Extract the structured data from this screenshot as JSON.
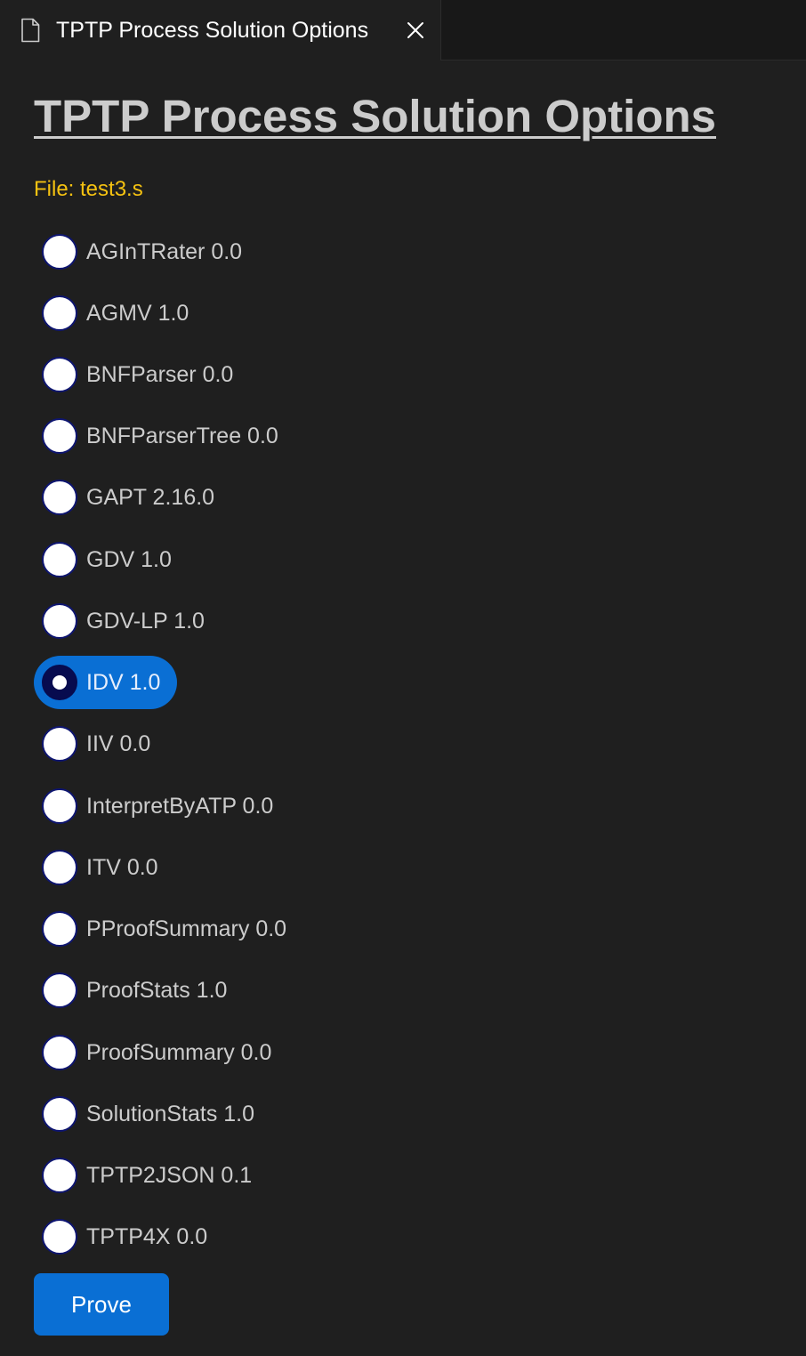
{
  "tab": {
    "title": "TPTP Process Solution Options",
    "icon": "file-icon",
    "close_icon": "close-icon"
  },
  "page": {
    "title": "TPTP Process Solution Options",
    "file_label": "File: test3.s"
  },
  "options": [
    {
      "label": "AGInTRater 0.0",
      "selected": false
    },
    {
      "label": "AGMV 1.0",
      "selected": false
    },
    {
      "label": "BNFParser 0.0",
      "selected": false
    },
    {
      "label": "BNFParserTree 0.0",
      "selected": false
    },
    {
      "label": "GAPT 2.16.0",
      "selected": false
    },
    {
      "label": "GDV 1.0",
      "selected": false
    },
    {
      "label": "GDV-LP 1.0",
      "selected": false
    },
    {
      "label": "IDV 1.0",
      "selected": true
    },
    {
      "label": "IIV 0.0",
      "selected": false
    },
    {
      "label": "InterpretByATP 0.0",
      "selected": false
    },
    {
      "label": "ITV 0.0",
      "selected": false
    },
    {
      "label": "PProofSummary 0.0",
      "selected": false
    },
    {
      "label": "ProofStats 1.0",
      "selected": false
    },
    {
      "label": "ProofSummary 0.0",
      "selected": false
    },
    {
      "label": "SolutionStats 1.0",
      "selected": false
    },
    {
      "label": "TPTP2JSON 0.1",
      "selected": false
    },
    {
      "label": "TPTP4X 0.0",
      "selected": false
    }
  ],
  "actions": {
    "prove_label": "Prove"
  },
  "colors": {
    "background": "#1f1f1f",
    "accent": "#0a6fd4",
    "file_label": "#f5c211",
    "text": "#cccccc"
  }
}
